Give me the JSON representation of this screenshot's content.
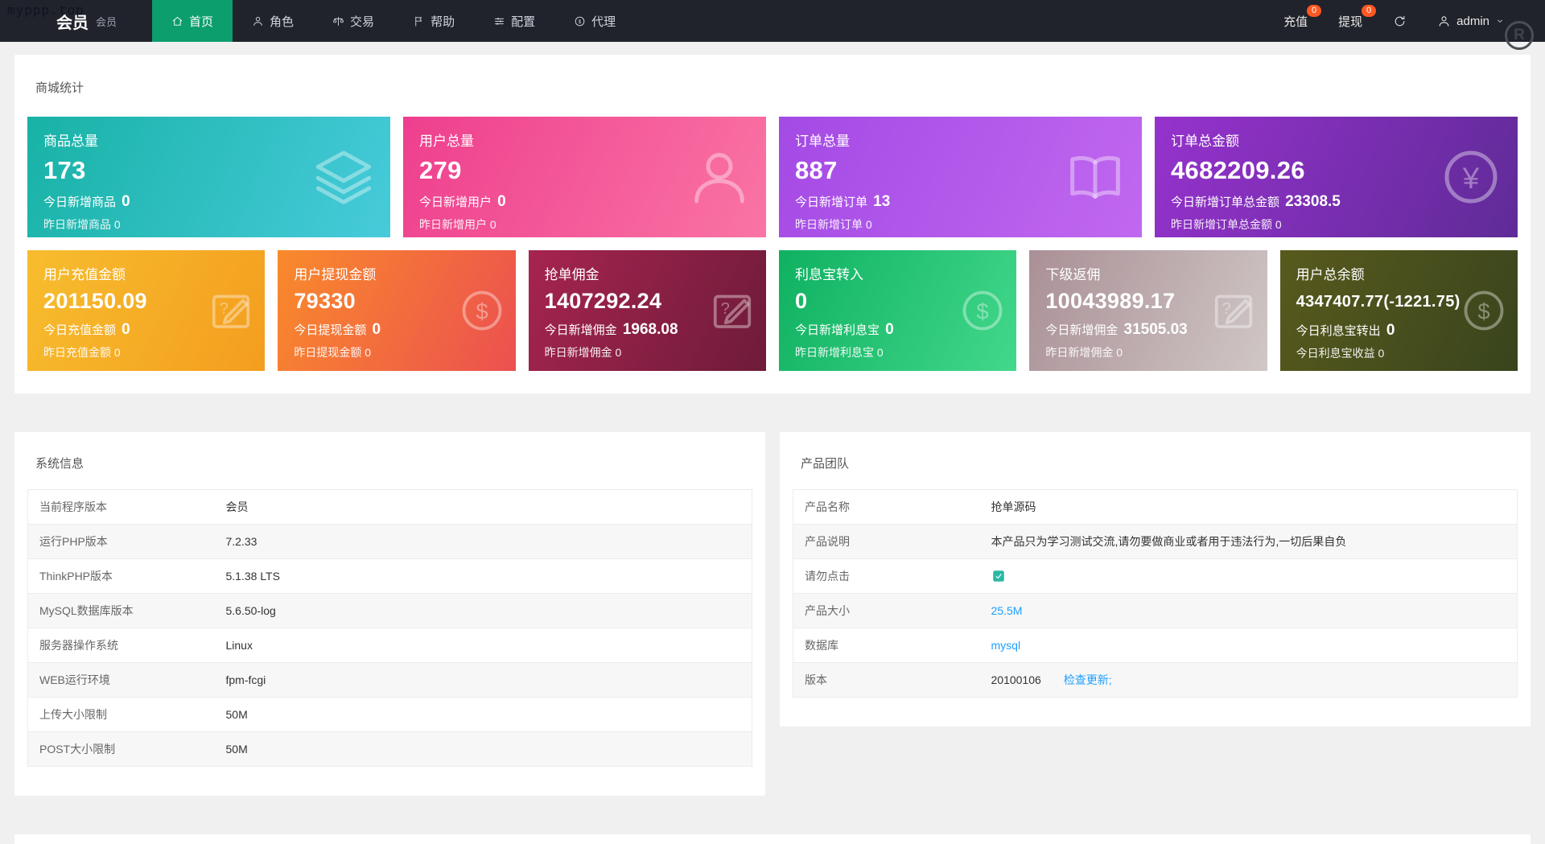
{
  "watermark": {
    "site": "myppp.top",
    "registered": "R"
  },
  "colors": {
    "accent_green": "#0c9e6c",
    "badge_orange": "#ff5722",
    "link_blue": "#1e9fff",
    "navbar_bg": "#20232b"
  },
  "navbar": {
    "brand": "会员",
    "brand_sub": "会员",
    "menu": [
      {
        "label": "首页",
        "icon": "home",
        "active": true
      },
      {
        "label": "角色",
        "icon": "person",
        "active": false
      },
      {
        "label": "交易",
        "icon": "trade",
        "active": false
      },
      {
        "label": "帮助",
        "icon": "flag",
        "active": false
      },
      {
        "label": "配置",
        "icon": "config",
        "active": false
      },
      {
        "label": "代理",
        "icon": "agent",
        "active": false
      }
    ],
    "recharge": {
      "label": "充值",
      "badge": "0"
    },
    "withdraw": {
      "label": "提现",
      "badge": "0"
    },
    "user": "admin"
  },
  "stats": {
    "title": "商城统计",
    "big_cards": [
      {
        "title": "商品总量",
        "value": "173",
        "today_label": "今日新增商品",
        "today_value": "0",
        "yesterday_label": "昨日新增商品",
        "yesterday_value": "0",
        "icon": "layers",
        "colors": [
          "#18b2a6",
          "#47cbdb"
        ]
      },
      {
        "title": "用户总量",
        "value": "279",
        "today_label": "今日新增用户",
        "today_value": "0",
        "yesterday_label": "昨日新增用户",
        "yesterday_value": "0",
        "icon": "user",
        "colors": [
          "#ee3f8e",
          "#fa74a4"
        ]
      },
      {
        "title": "订单总量",
        "value": "887",
        "today_label": "今日新增订单",
        "today_value": "13",
        "yesterday_label": "昨日新增订单",
        "yesterday_value": "0",
        "icon": "book",
        "colors": [
          "#a44ae5",
          "#c168f0"
        ]
      },
      {
        "title": "订单总金额",
        "value": "4682209.26",
        "today_label": "今日新增订单总金额",
        "today_value": "23308.5",
        "yesterday_label": "昨日新增订单总金额",
        "yesterday_value": "0",
        "icon": "yen",
        "colors": [
          "#9632cd",
          "#5f2b97"
        ]
      }
    ],
    "small_cards": [
      {
        "title": "用户充值金额",
        "value": "201150.09",
        "today_label": "今日充值金额",
        "today_value": "0",
        "yesterday_label": "昨日充值金额",
        "yesterday_value": "0",
        "icon": "edit",
        "colors": [
          "#f7bd2e",
          "#f49d1f"
        ]
      },
      {
        "title": "用户提现金额",
        "value": "79330",
        "today_label": "今日提现金额",
        "today_value": "0",
        "yesterday_label": "昨日提现金额",
        "yesterday_value": "0",
        "icon": "dollar",
        "colors": [
          "#f98a2b",
          "#ec5050"
        ]
      },
      {
        "title": "抢单佣金",
        "value": "1407292.24",
        "today_label": "今日新增佣金",
        "today_value": "1968.08",
        "yesterday_label": "昨日新增佣金",
        "yesterday_value": "0",
        "icon": "edit",
        "colors": [
          "#a62450",
          "#6e1b39"
        ]
      },
      {
        "title": "利息宝转入",
        "value": "0",
        "today_label": "今日新增利息宝",
        "today_value": "0",
        "yesterday_label": "昨日新增利息宝",
        "yesterday_value": "0",
        "icon": "dollar",
        "colors": [
          "#0fb161",
          "#43d88b"
        ]
      },
      {
        "title": "下级返佣",
        "value": "10043989.17",
        "today_label": "今日新增佣金",
        "today_value": "31505.03",
        "yesterday_label": "昨日新增佣金",
        "yesterday_value": "0",
        "icon": "edit",
        "colors": [
          "#aa9096",
          "#d0c7c6"
        ]
      },
      {
        "title": "用户总余额",
        "value": "4347407.77(-1221.75)",
        "today_label": "今日利息宝转出",
        "today_value": "0",
        "yesterday_label": "今日利息宝收益",
        "yesterday_value": "0",
        "icon": "dollar",
        "colors": [
          "#585a1d",
          "#39441d"
        ]
      }
    ]
  },
  "system_info": {
    "title": "系统信息",
    "rows": [
      {
        "label": "当前程序版本",
        "value": "会员"
      },
      {
        "label": "运行PHP版本",
        "value": "7.2.33"
      },
      {
        "label": "ThinkPHP版本",
        "value": "5.1.38 LTS"
      },
      {
        "label": "MySQL数据库版本",
        "value": "5.6.50-log"
      },
      {
        "label": "服务器操作系统",
        "value": "Linux"
      },
      {
        "label": "WEB运行环境",
        "value": "fpm-fcgi"
      },
      {
        "label": "上传大小限制",
        "value": "50M"
      },
      {
        "label": "POST大小限制",
        "value": "50M"
      }
    ]
  },
  "product_team": {
    "title": "产品团队",
    "rows": [
      {
        "label": "产品名称",
        "value": "抢单源码"
      },
      {
        "label": "产品说明",
        "value": "本产品只为学习测试交流,请勿要做商业或者用于违法行为,一切后果自负"
      },
      {
        "label": "请勿点击",
        "icon": "app"
      },
      {
        "label": "产品大小",
        "value": "25.5M",
        "is_link": true
      },
      {
        "label": "数据库",
        "value": "mysql",
        "is_link": true
      },
      {
        "label": "版本",
        "value": "20100106",
        "extra_link": "检查更新;"
      }
    ]
  }
}
